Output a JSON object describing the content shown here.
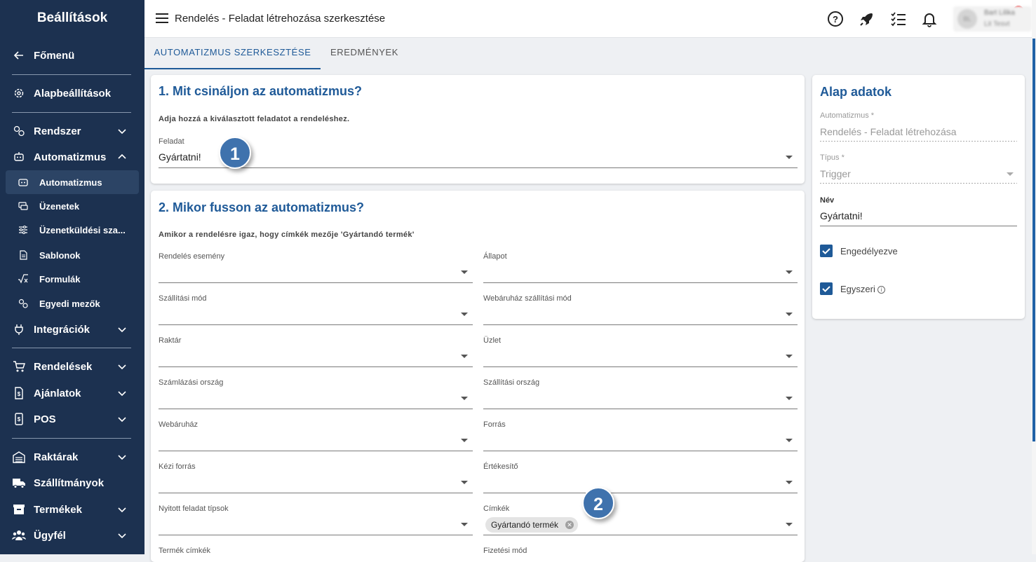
{
  "sidebar": {
    "title": "Beállítások",
    "items": [
      {
        "label": "Főmenü",
        "icon": "arrow-left-icon"
      },
      {
        "label": "Alapbeállítások",
        "icon": "gear-icon"
      },
      {
        "label": "Rendszer",
        "icon": "gears-icon"
      },
      {
        "label": "Automatizmus",
        "icon": "robot-icon"
      },
      {
        "label": "Integrációk",
        "icon": "plug-icon"
      },
      {
        "label": "Rendelések",
        "icon": "cart-icon"
      },
      {
        "label": "Ajánlatok",
        "icon": "document-dollar-icon"
      },
      {
        "label": "POS",
        "icon": "pos-icon"
      },
      {
        "label": "Raktárak",
        "icon": "warehouse-icon"
      },
      {
        "label": "Szállítmányok",
        "icon": "truck-icon"
      },
      {
        "label": "Termékek",
        "icon": "box-icon"
      },
      {
        "label": "Ügyfél",
        "icon": "users-icon"
      }
    ],
    "subitems": [
      {
        "label": "Automatizmus",
        "icon": "robot-icon",
        "active": true
      },
      {
        "label": "Üzenetek",
        "icon": "messages-icon"
      },
      {
        "label": "Üzenetküldési sza...",
        "icon": "sliders-icon"
      },
      {
        "label": "Sablonok",
        "icon": "file-icon"
      },
      {
        "label": "Formulák",
        "icon": "square-root-icon"
      },
      {
        "label": "Egyedi mezők",
        "icon": "gears-icon"
      }
    ]
  },
  "header": {
    "title": "Rendelés - Feladat létrehozása szerkesztése",
    "notification_count": "1",
    "user": {
      "initials": "BL",
      "name": "Bart Lilika",
      "company": "Lit Tesvt"
    }
  },
  "tabs": [
    {
      "label": "AUTOMATIZMUS SZERKESZTÉSE",
      "active": true
    },
    {
      "label": "EREDMÉNYEK",
      "active": false
    }
  ],
  "section1": {
    "title": "1. Mit csináljon az automatizmus?",
    "description": "Adja hozzá a kiválasztott feladatot a rendeléshez.",
    "field_label": "Feladat",
    "field_value": "Gyártatni!",
    "marker": "1"
  },
  "section2": {
    "title": "2. Mikor fusson az automatizmus?",
    "description": "Amikor a rendelésre igaz, hogy címkék mezője 'Gyártandó termék'",
    "fields": [
      {
        "label": "Rendelés esemény"
      },
      {
        "label": "Állapot"
      },
      {
        "label": "Szállítási mód"
      },
      {
        "label": "Webáruház szállítási mód"
      },
      {
        "label": "Raktár"
      },
      {
        "label": "Üzlet"
      },
      {
        "label": "Számlázási ország"
      },
      {
        "label": "Szállítási ország"
      },
      {
        "label": "Webáruház"
      },
      {
        "label": "Forrás"
      },
      {
        "label": "Kézi forrás"
      },
      {
        "label": "Értékesítő"
      },
      {
        "label": "Nyitott feladat típsok"
      },
      {
        "label": "Címkék",
        "chip": "Gyártandó termék"
      },
      {
        "label": "Termék címkék"
      },
      {
        "label": "Fizetési mód"
      }
    ],
    "marker": "2"
  },
  "basic": {
    "title": "Alap adatok",
    "automation_label": "Automatizmus *",
    "automation_value": "Rendelés - Feladat létrehozása",
    "type_label": "Típus *",
    "type_value": "Trigger",
    "name_label": "Név",
    "name_value": "Gyártatni!",
    "enabled_label": "Engedélyezve",
    "once_label": "Egyszeri"
  }
}
